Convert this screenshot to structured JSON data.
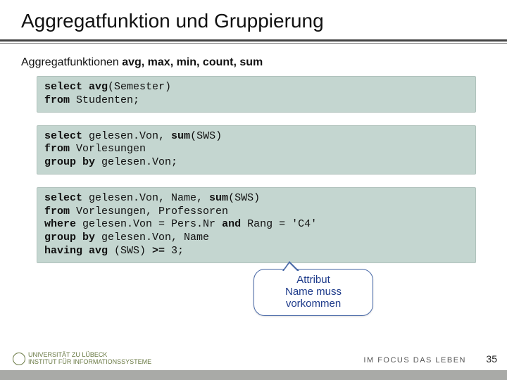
{
  "title": "Aggregatfunktion und Gruppierung",
  "subhead_prefix": "Aggregatfunktionen ",
  "subhead_bold": "avg, max, min, count, sum",
  "code1": "<b>select avg</b>(Semester)\n<b>from</b> Studenten;",
  "code2": "<b>select</b> gelesen.Von, <b>sum</b>(SWS)\n<b>from</b> Vorlesungen\n<b>group by</b> gelesen.Von;",
  "code3": "<b>select</b> gelesen.Von, Name, <b>sum</b>(SWS)\n<b>from</b> Vorlesungen, Professoren\n<b>where</b> gelesen.Von = Pers.Nr <b>and</b> Rang = 'C4'\n<b>group by</b> gelesen.Von, Name\n<b>having avg</b> (SWS) <b>&gt;=</b> 3;",
  "callout": "Attribut\nName muss\nvorkommen",
  "logo_left_line1": "UNIVERSITÄT ZU LÜBECK",
  "logo_left_line2": "INSTITUT FÜR INFORMATIONSSYSTEME",
  "logo_right": "IM FOCUS DAS LEBEN",
  "page": "35"
}
